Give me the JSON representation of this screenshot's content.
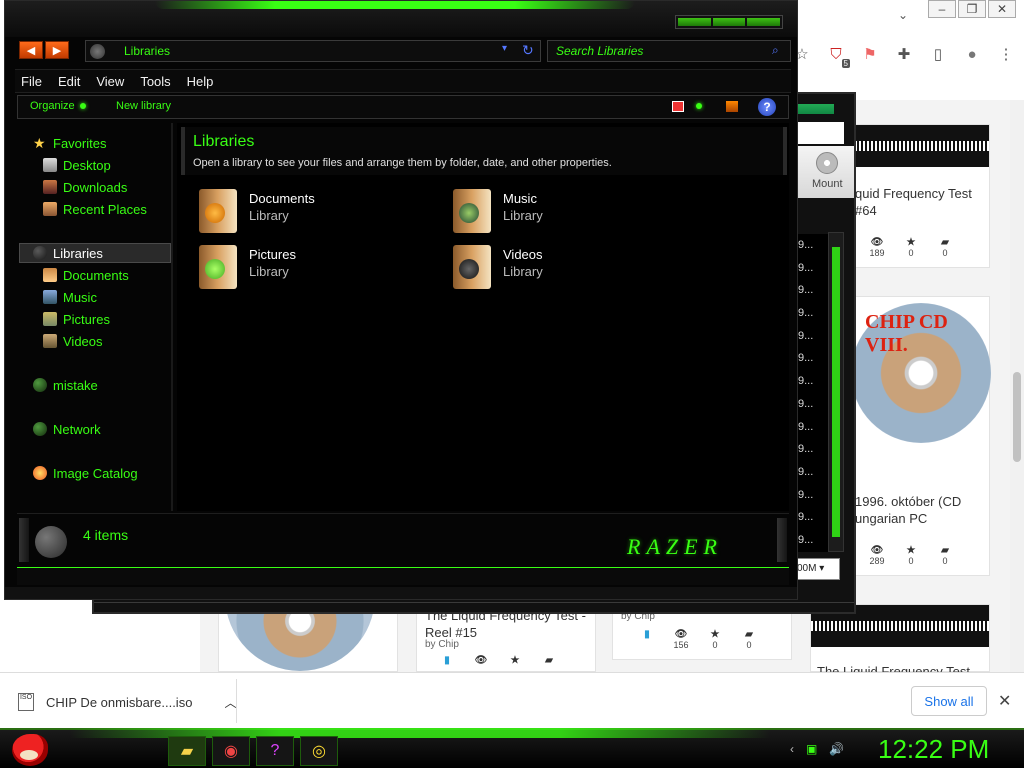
{
  "browser": {
    "toolbar_icons": [
      "star-icon",
      "extension-badge-icon",
      "flag-icon",
      "puzzle-icon",
      "sidepanel-icon",
      "profile-icon",
      "more-icon"
    ],
    "extension_badge": "5",
    "window_controls": [
      "minimize",
      "restore",
      "close"
    ],
    "feed": {
      "cards": [
        {
          "title": "quid Frequency Test #64",
          "views": "189",
          "stars": "0",
          "comments": "0"
        },
        {
          "title": "1996. október (CD ungarian PC",
          "cd_label": "CHIP CD VIII.",
          "views": "289",
          "stars": "0",
          "comments": "0"
        },
        {
          "title": "The Liquid Frequency Test - Reel #15",
          "by": "by Chip",
          "views": "",
          "stars": "",
          "comments": ""
        },
        {
          "title": "",
          "by": "by Chip",
          "views": "156",
          "stars": "0",
          "comments": "0"
        },
        {
          "title": "The Liquid Frequency Test"
        }
      ]
    }
  },
  "download_bar": {
    "file_name": "CHIP De onmisbare....iso",
    "show_all": "Show all"
  },
  "back_window": {
    "mount_label": "Mount",
    "list_rows": [
      "9...",
      "9...",
      "9...",
      "9...",
      "9...",
      "9...",
      "9...",
      "9...",
      "9...",
      "9...",
      "9...",
      "9...",
      "9...",
      "9..."
    ],
    "combo_value": "00M"
  },
  "explorer": {
    "address": "Libraries",
    "search_placeholder": "Search Libraries",
    "menu": [
      "File",
      "Edit",
      "View",
      "Tools",
      "Help"
    ],
    "commands": {
      "organize": "Organize",
      "new_library": "New library"
    },
    "nav": {
      "favorites": "Favorites",
      "desktop": "Desktop",
      "downloads": "Downloads",
      "recent": "Recent Places",
      "libraries": "Libraries",
      "lib_documents": "Documents",
      "lib_music": "Music",
      "lib_pictures": "Pictures",
      "lib_videos": "Videos",
      "mistake": "mistake",
      "network": "Network",
      "image_catalog": "Image Catalog"
    },
    "header": {
      "title": "Libraries",
      "description": "Open a library to see your files and arrange them by folder, date, and other properties."
    },
    "libraries": [
      {
        "name": "Documents",
        "type": "Library"
      },
      {
        "name": "Music",
        "type": "Library"
      },
      {
        "name": "Pictures",
        "type": "Library"
      },
      {
        "name": "Videos",
        "type": "Library"
      }
    ],
    "item_count": "4 items",
    "brand": "RAZER"
  },
  "taskbar": {
    "clock": "12:22 PM",
    "apps": [
      "explorer-icon",
      "chrome-icon",
      "help-icon",
      "disc-icon"
    ]
  },
  "colors": {
    "accent": "#39ff14",
    "window_bg": "#050505",
    "link_blue": "#1a73e8"
  }
}
